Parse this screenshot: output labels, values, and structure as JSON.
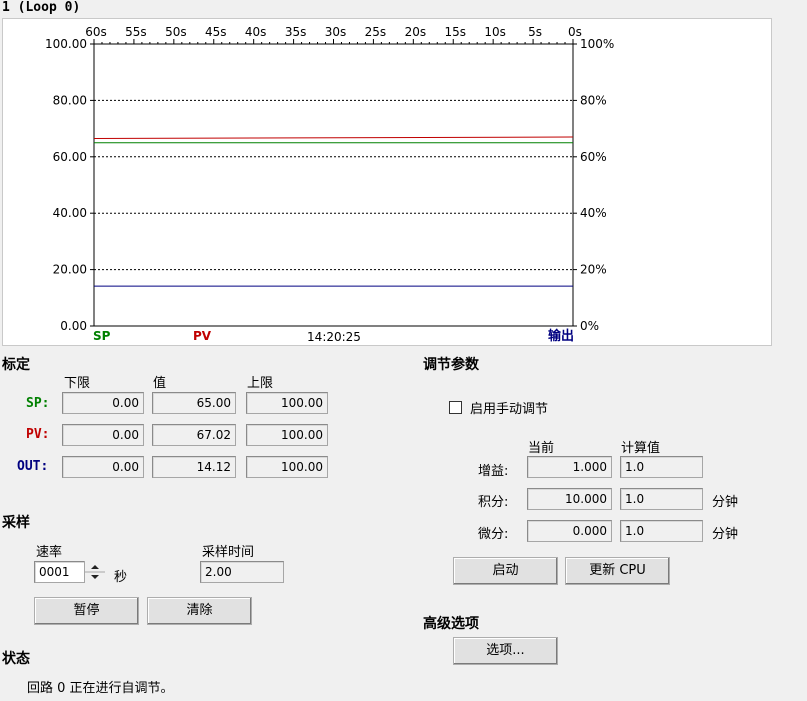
{
  "window": {
    "title": "1 (Loop 0)"
  },
  "chart": {
    "x_ticks": [
      "60s",
      "55s",
      "50s",
      "45s",
      "40s",
      "35s",
      "30s",
      "25s",
      "20s",
      "15s",
      "10s",
      "5s",
      "0s"
    ],
    "y_left_ticks": [
      "100.00",
      "80.00",
      "60.00",
      "40.00",
      "20.00",
      "0.00"
    ],
    "y_right_ticks": [
      "100%",
      "80%",
      "60%",
      "40%",
      "20%",
      "0%"
    ],
    "legend_sp": "SP",
    "legend_pv": "PV",
    "legend_out": "输出",
    "time": "14:20:25",
    "colors": {
      "sp": "#008000",
      "pv": "#c00000",
      "out": "#000080"
    }
  },
  "chart_data": {
    "type": "line",
    "x": [
      60,
      0
    ],
    "xlim": [
      60,
      0
    ],
    "ylim": [
      0,
      100
    ],
    "grid": true,
    "series": [
      {
        "name": "SP",
        "values": [
          65.0,
          65.0
        ],
        "color": "#008000"
      },
      {
        "name": "PV",
        "values": [
          66.5,
          67.02
        ],
        "color": "#c00000"
      },
      {
        "name": "输出",
        "values": [
          14.12,
          14.12
        ],
        "color": "#000080"
      }
    ]
  },
  "calibration": {
    "heading": "标定",
    "col_low": "下限",
    "col_value": "值",
    "col_high": "上限",
    "rows": [
      {
        "label": "SP:",
        "low": "0.00",
        "value": "65.00",
        "high": "100.00",
        "color": "#008000"
      },
      {
        "label": "PV:",
        "low": "0.00",
        "value": "67.02",
        "high": "100.00",
        "color": "#c00000"
      },
      {
        "label": "OUT:",
        "low": "0.00",
        "value": "14.12",
        "high": "100.00",
        "color": "#000080"
      }
    ]
  },
  "tuning": {
    "heading": "调节参数",
    "manual_label": "启用手动调节",
    "manual_checked": false,
    "col_current": "当前",
    "col_calc": "计算值",
    "gain_label": "增益:",
    "gain_current": "1.000",
    "gain_calc": "1.0",
    "integral_label": "积分:",
    "integral_current": "10.000",
    "integral_calc": "1.0",
    "integral_unit": "分钟",
    "derivative_label": "微分:",
    "derivative_current": "0.000",
    "derivative_calc": "1.0",
    "derivative_unit": "分钟",
    "start_button": "启动",
    "update_button": "更新 CPU"
  },
  "sampling": {
    "heading": "采样",
    "rate_label": "速率",
    "rate_value": "0001",
    "rate_unit": "秒",
    "time_label": "采样时间",
    "time_value": "2.00",
    "pause_button": "暂停",
    "clear_button": "清除"
  },
  "advanced": {
    "heading": "高级选项",
    "options_button": "选项..."
  },
  "status": {
    "heading": "状态",
    "message": "回路 0 正在进行自调节。"
  }
}
